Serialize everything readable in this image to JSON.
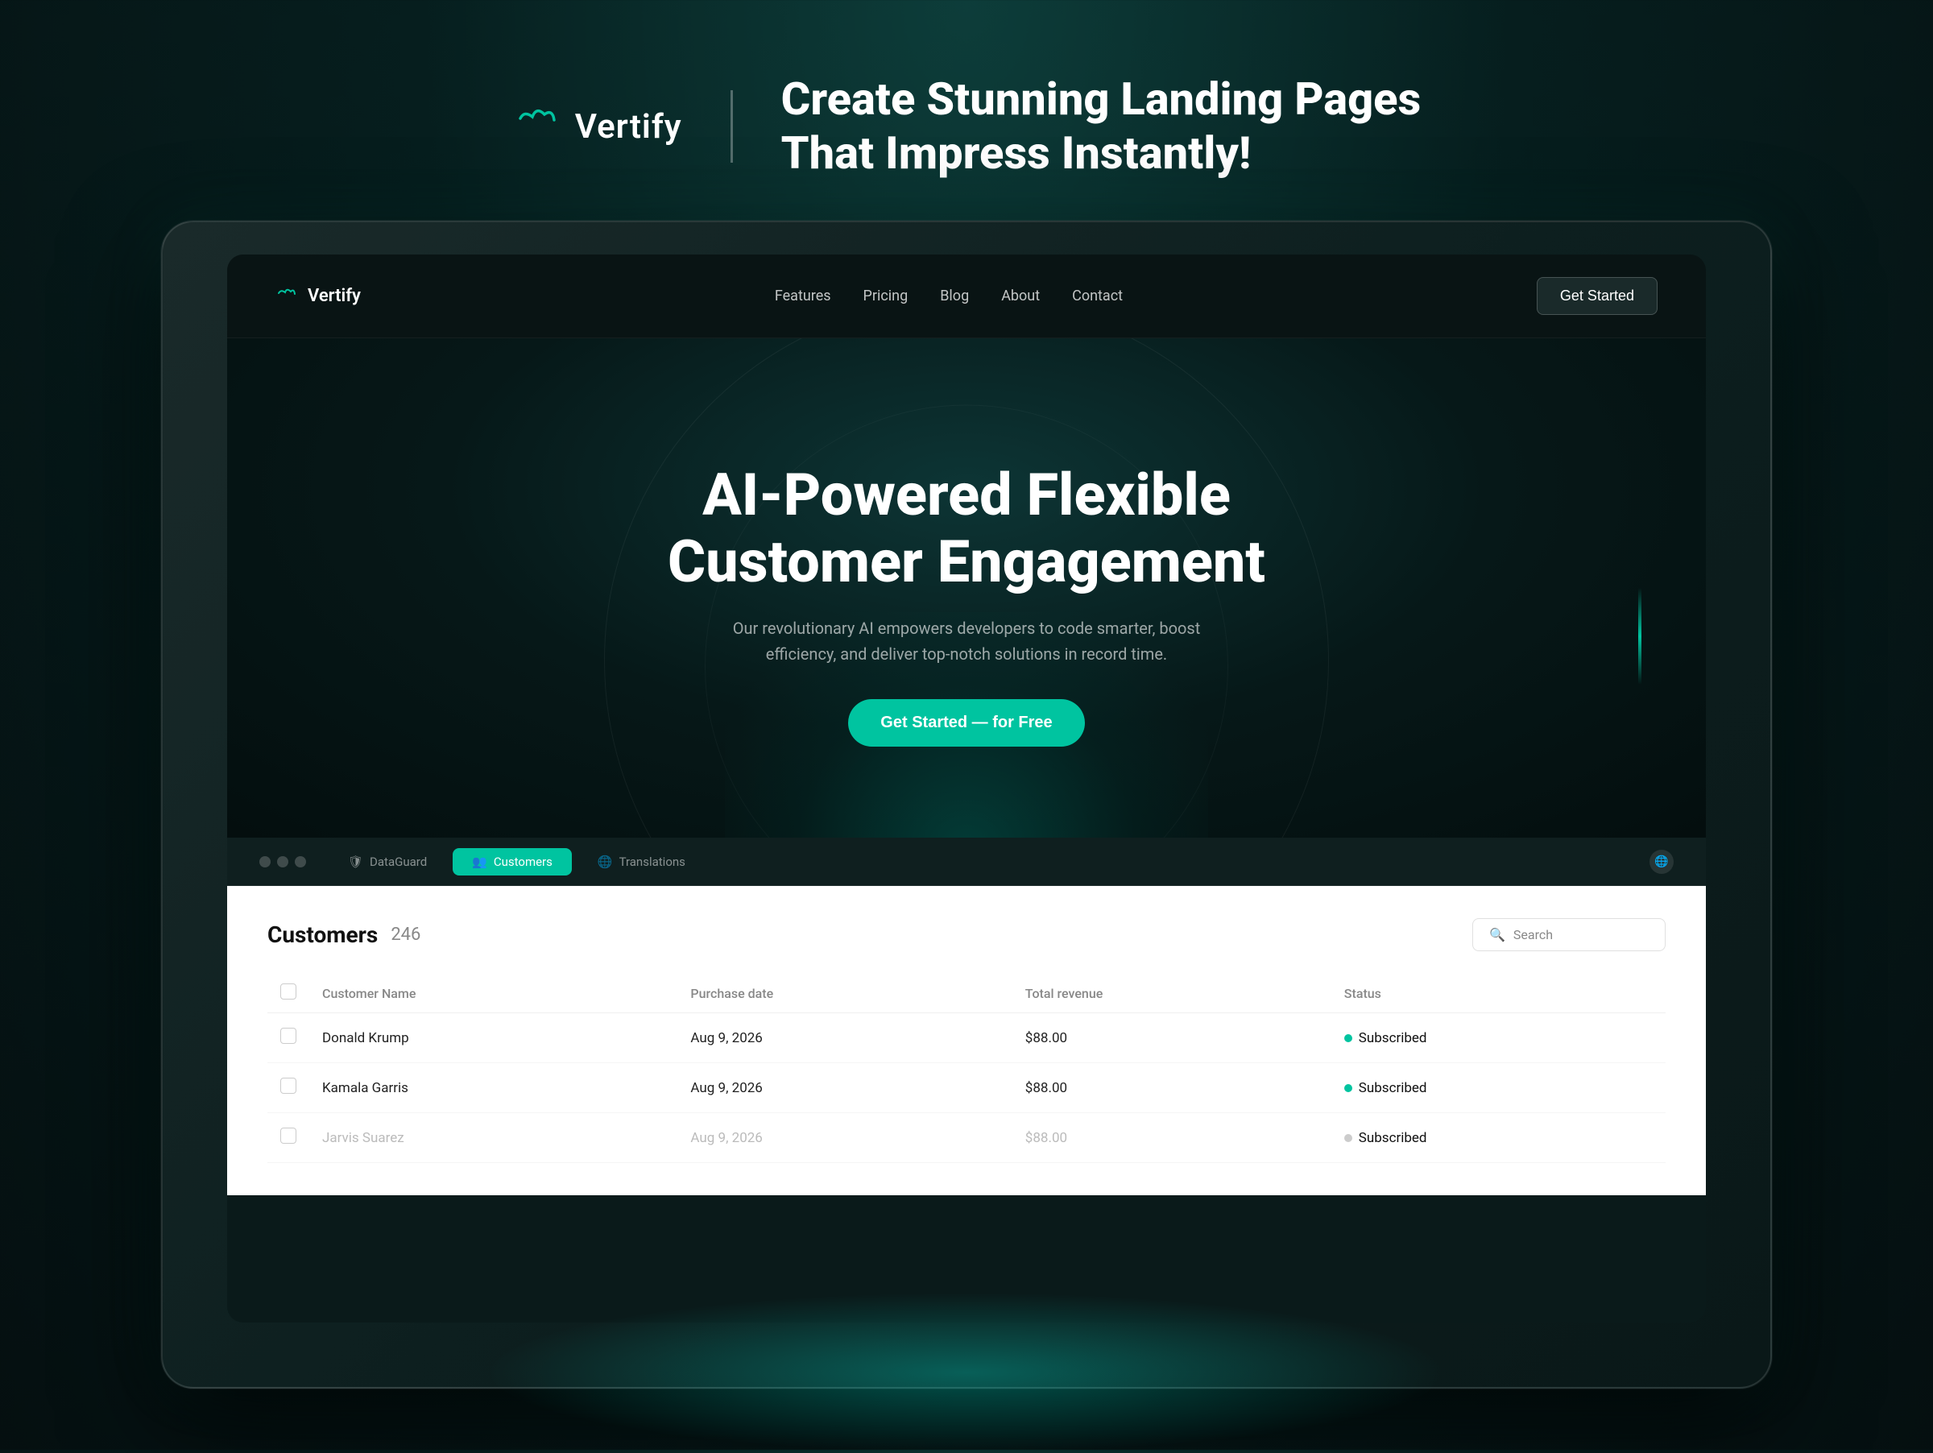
{
  "branding": {
    "logo_name": "Vertify",
    "tagline_line1": "Create Stunning Landing Pages",
    "tagline_line2": "That Impress Instantly!"
  },
  "navbar": {
    "logo": "Vertify",
    "links": [
      "Features",
      "Pricing",
      "Blog",
      "About",
      "Contact"
    ],
    "cta": "Get Started"
  },
  "hero": {
    "title_line1": "AI-Powered Flexible",
    "title_line2": "Customer Engagement",
    "subtitle": "Our revolutionary AI empowers developers to code smarter, boost efficiency, and deliver top-notch solutions in record time.",
    "cta_button": "Get Started — for Free"
  },
  "tabs": {
    "items": [
      {
        "label": "DataGuard",
        "icon": "shield"
      },
      {
        "label": "Customers",
        "icon": "users",
        "active": true
      },
      {
        "label": "Translations",
        "icon": "globe"
      }
    ]
  },
  "customers_panel": {
    "title": "Customers",
    "count": "246",
    "search_placeholder": "Search",
    "columns": [
      "Customer Name",
      "Purchase date",
      "Total revenue",
      "Status"
    ],
    "rows": [
      {
        "name": "Donald Krump",
        "purchase_date": "Aug 9, 2026",
        "revenue": "$88.00",
        "status": "Subscribed",
        "faded": false
      },
      {
        "name": "Kamala Garris",
        "purchase_date": "Aug 9, 2026",
        "revenue": "$88.00",
        "status": "Subscribed",
        "faded": false
      },
      {
        "name": "Jarvis Suarez",
        "purchase_date": "Aug 9, 2026",
        "revenue": "$88.00",
        "status": "Subscribed",
        "faded": true
      }
    ]
  },
  "colors": {
    "accent": "#00c4a0",
    "bg_dark": "#061e1e",
    "bg_panel": "#ffffff"
  }
}
